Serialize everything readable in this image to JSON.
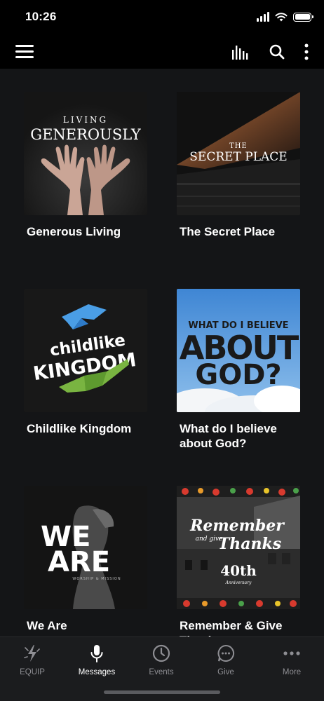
{
  "status": {
    "time": "10:26"
  },
  "toolbar": {
    "menu_icon": "hamburger-menu-icon",
    "icons": [
      "equalizer-icon",
      "search-icon",
      "more-vertical-icon"
    ]
  },
  "series": [
    {
      "title": "Generous Living",
      "art_line1": "LIVING",
      "art_line2": "GENEROUSLY"
    },
    {
      "title": "The Secret Place",
      "art_line1": "THE",
      "art_line2": "SECRET PLACE"
    },
    {
      "title": "Childlike Kingdom",
      "art_line1": "childlike",
      "art_line2": "KINGDOM"
    },
    {
      "title": "What do I believe about God?",
      "art_line1": "WHAT DO I BELIEVE",
      "art_line2": "ABOUT",
      "art_line3": "GOD?"
    },
    {
      "title": "We Are",
      "art_line1": "WE",
      "art_line2": "ARE",
      "art_line3": "WORSHIP & MISSION"
    },
    {
      "title": "Remember & Give Thanks",
      "art_line1": "Remember",
      "art_line2": "and give",
      "art_line3": "Thanks",
      "art_line4": "40th",
      "art_line5": "Anniversary"
    }
  ],
  "tabs": [
    {
      "label": "EQUIP",
      "icon": "equip-icon"
    },
    {
      "label": "Messages",
      "icon": "microphone-icon",
      "active": true
    },
    {
      "label": "Events",
      "icon": "clock-icon"
    },
    {
      "label": "Give",
      "icon": "give-chat-icon"
    },
    {
      "label": "More",
      "icon": "more-dots-icon"
    }
  ],
  "colors": {
    "background": "#141517",
    "tabbar": "#1b1c1e",
    "active_tab": "#ffffff",
    "inactive_tab": "#8e8e93"
  }
}
